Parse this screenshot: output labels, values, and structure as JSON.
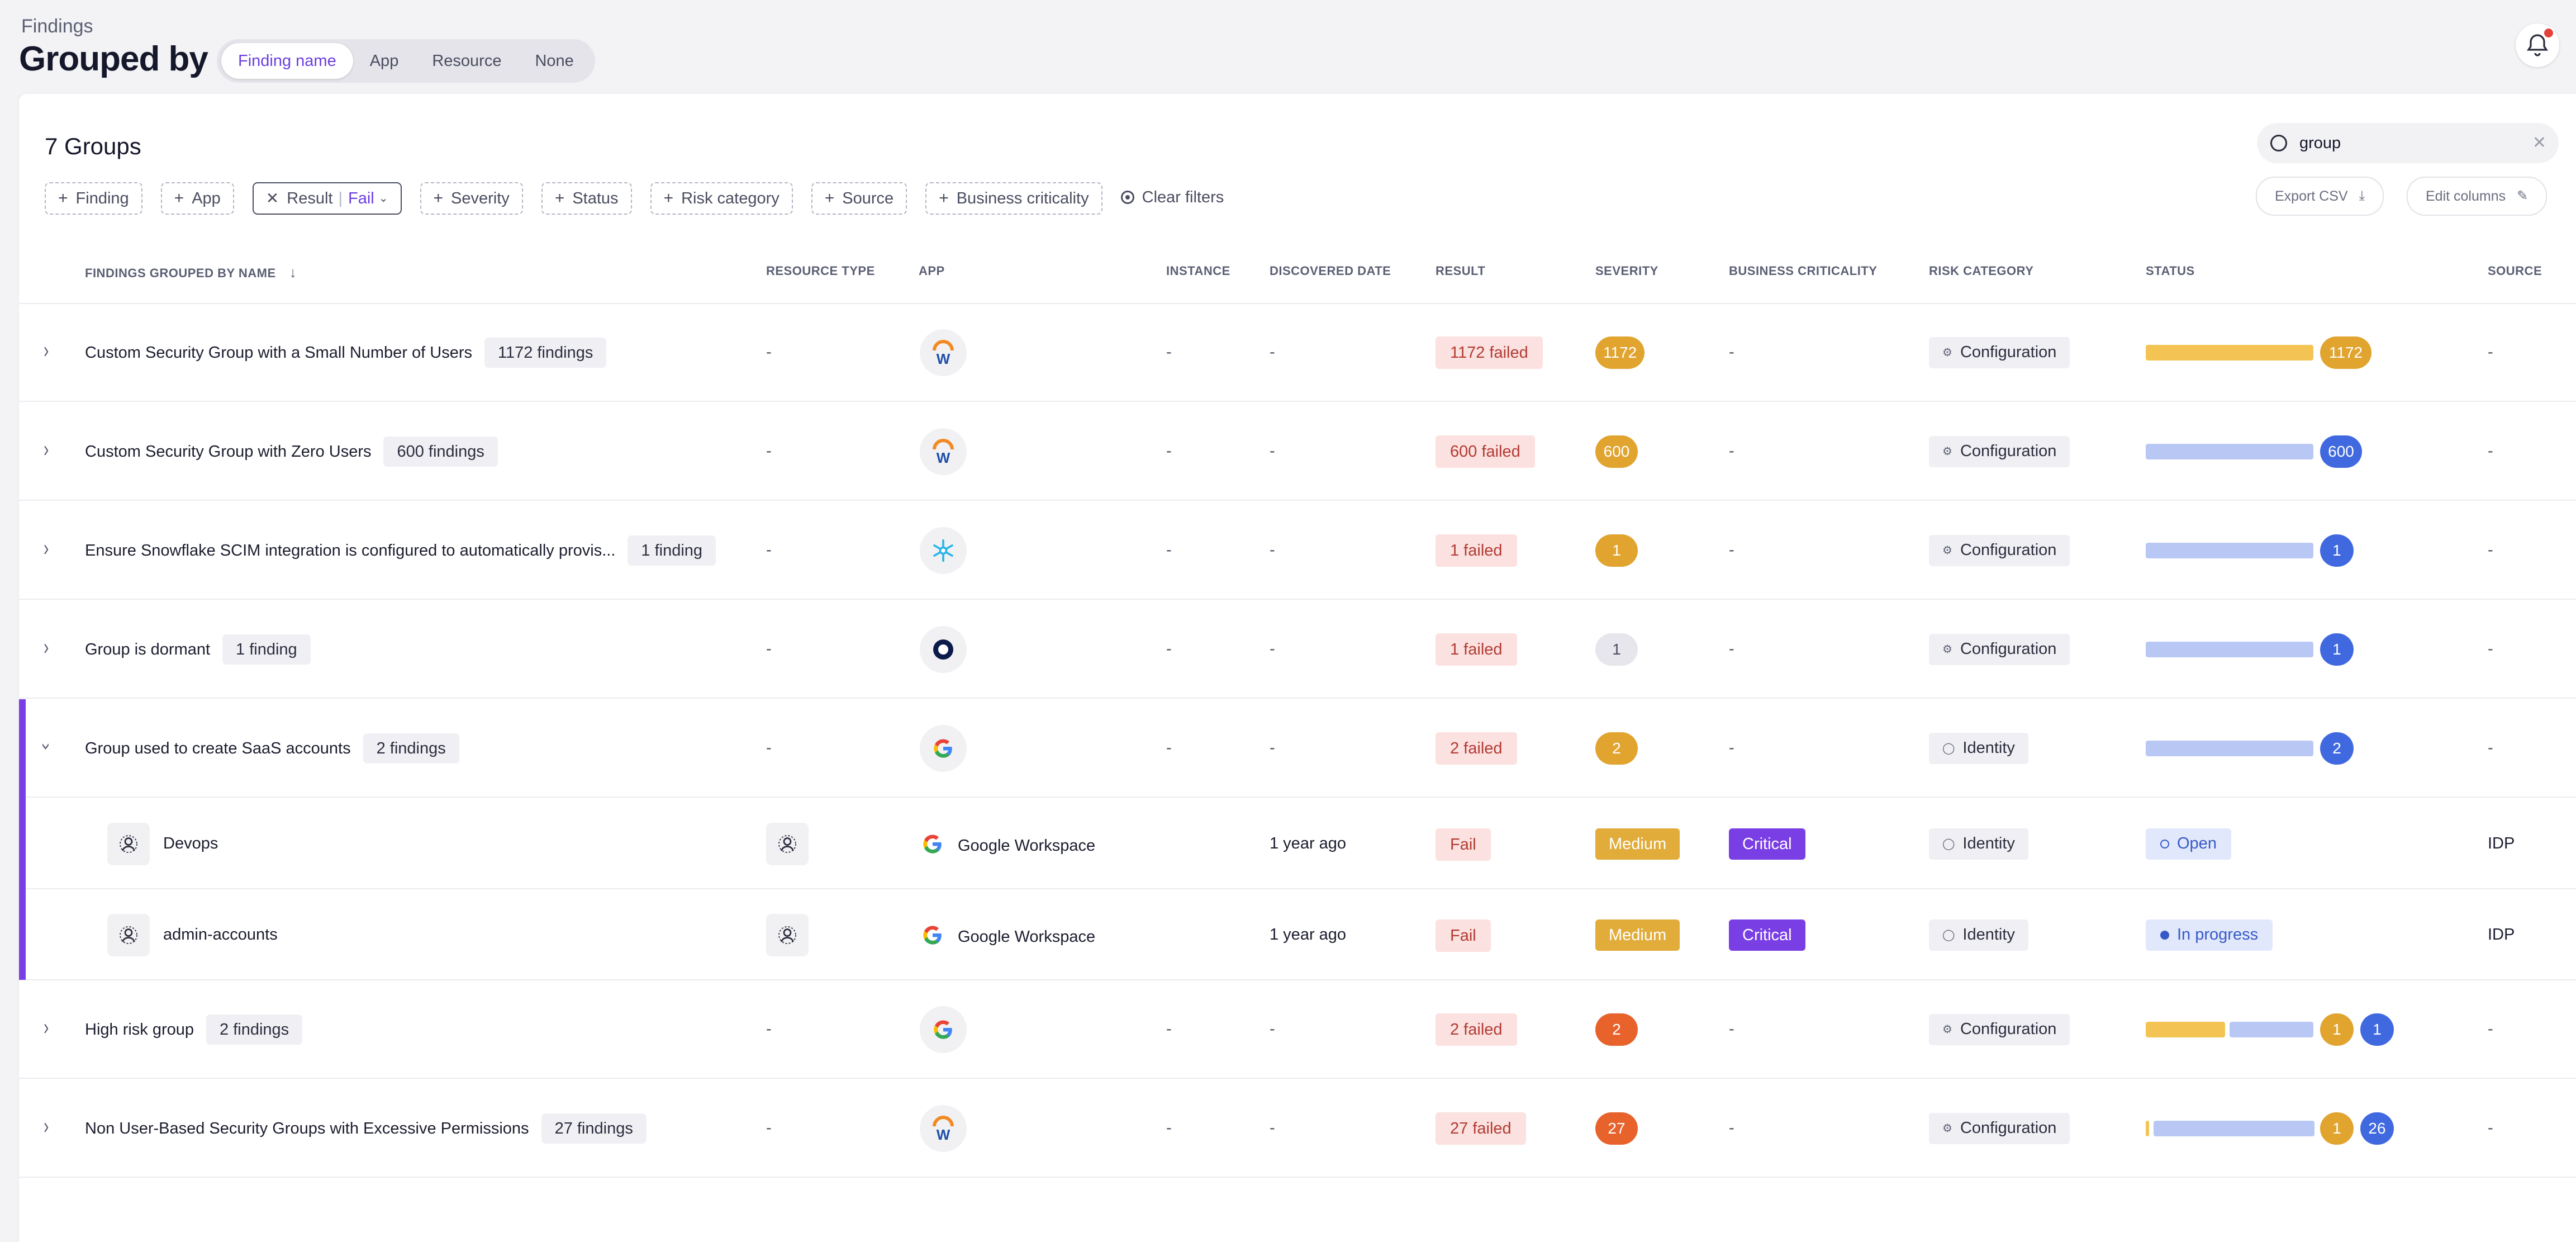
{
  "header": {
    "breadcrumb": "Findings",
    "title": "Grouped by",
    "group_options": [
      "Finding name",
      "App",
      "Resource",
      "None"
    ],
    "group_active": "Finding name"
  },
  "toolbar": {
    "groups_count": "7 Groups",
    "search_value": "group",
    "export_csv": "Export CSV",
    "edit_columns": "Edit columns",
    "clear_filters": "Clear filters",
    "filters": {
      "finding": "Finding",
      "app": "App",
      "result_label": "Result",
      "result_value": "Fail",
      "severity": "Severity",
      "status": "Status",
      "risk_category": "Risk category",
      "source": "Source",
      "business_criticality": "Business criticality"
    }
  },
  "columns": {
    "name": "FINDINGS GROUPED BY NAME",
    "resource_type": "RESOURCE TYPE",
    "app": "APP",
    "instance": "INSTANCE",
    "discovered_date": "DISCOVERED DATE",
    "result": "RESULT",
    "severity": "SEVERITY",
    "business_criticality": "BUSINESS CRITICALITY",
    "risk_category": "RISK CATEGORY",
    "status": "STATUS",
    "source": "SOURCE"
  },
  "dash": "-",
  "groups": [
    {
      "name": "Custom Security Group with a Small Number of Users",
      "count": "1172 findings",
      "app": "workday",
      "result": "1172 failed",
      "severity": "1172",
      "severity_color": "yellow",
      "risk": "Configuration",
      "status_bars": [
        {
          "color": "#f3c453",
          "fraction": 1.0
        }
      ],
      "status_badges": [
        {
          "value": "1172",
          "color": "#e0a42f"
        }
      ]
    },
    {
      "name": "Custom Security Group with Zero Users",
      "count": "600 findings",
      "app": "workday",
      "result": "600 failed",
      "severity": "600",
      "severity_color": "yellow",
      "risk": "Configuration",
      "status_bars": [
        {
          "color": "#b9c7f4",
          "fraction": 1.0
        }
      ],
      "status_badges": [
        {
          "value": "600",
          "color": "#4069e0"
        }
      ]
    },
    {
      "name": "Ensure Snowflake SCIM integration is configured to automatically provis...",
      "count": "1 finding",
      "app": "snowflake",
      "result": "1 failed",
      "severity": "1",
      "severity_color": "yellow",
      "risk": "Configuration",
      "status_bars": [
        {
          "color": "#b9c7f4",
          "fraction": 1.0
        }
      ],
      "status_badges": [
        {
          "value": "1",
          "color": "#4069e0"
        }
      ]
    },
    {
      "name": "Group is dormant",
      "count": "1 finding",
      "app": "okta",
      "result": "1 failed",
      "severity": "1",
      "severity_color": "grey",
      "risk": "Configuration",
      "status_bars": [
        {
          "color": "#b9c7f4",
          "fraction": 1.0
        }
      ],
      "status_badges": [
        {
          "value": "1",
          "color": "#4069e0"
        }
      ]
    },
    {
      "name": "Group used to create SaaS accounts",
      "count": "2 findings",
      "app": "google",
      "result": "2 failed",
      "severity": "2",
      "severity_color": "yellow",
      "risk": "Identity",
      "status_bars": [
        {
          "color": "#b9c7f4",
          "fraction": 1.0
        }
      ],
      "status_badges": [
        {
          "value": "2",
          "color": "#4069e0"
        }
      ]
    },
    {
      "name": "High risk group",
      "count": "2 findings",
      "app": "google",
      "result": "2 failed",
      "severity": "2",
      "severity_color": "orange",
      "risk": "Configuration",
      "status_bars": [
        {
          "color": "#f3c453",
          "fraction": 0.5
        },
        {
          "color": "#b9c7f4",
          "fraction": 0.5
        }
      ],
      "status_badges": [
        {
          "value": "1",
          "color": "#e0a42f"
        },
        {
          "value": "1",
          "color": "#4069e0"
        }
      ]
    },
    {
      "name": "Non User-Based Security Groups with Excessive Permissions",
      "count": "27 findings",
      "app": "workday",
      "result": "27 failed",
      "severity": "27",
      "severity_color": "orange",
      "risk": "Configuration",
      "status_bars": [
        {
          "color": "#f3c453",
          "fraction": 0.04
        },
        {
          "color": "#b9c7f4",
          "fraction": 0.96
        }
      ],
      "status_badges": [
        {
          "value": "1",
          "color": "#e0a42f"
        },
        {
          "value": "26",
          "color": "#4069e0"
        }
      ]
    }
  ],
  "children": [
    {
      "name": "Devops",
      "app_name": "Google Workspace",
      "discovered": "1 year ago",
      "result": "Fail",
      "severity": "Medium",
      "criticality": "Critical",
      "risk": "Identity",
      "status": "Open",
      "source": "IDP"
    },
    {
      "name": "admin-accounts",
      "app_name": "Google Workspace",
      "discovered": "1 year ago",
      "result": "Fail",
      "severity": "Medium",
      "criticality": "Critical",
      "risk": "Identity",
      "status": "In progress",
      "source": "IDP"
    }
  ]
}
